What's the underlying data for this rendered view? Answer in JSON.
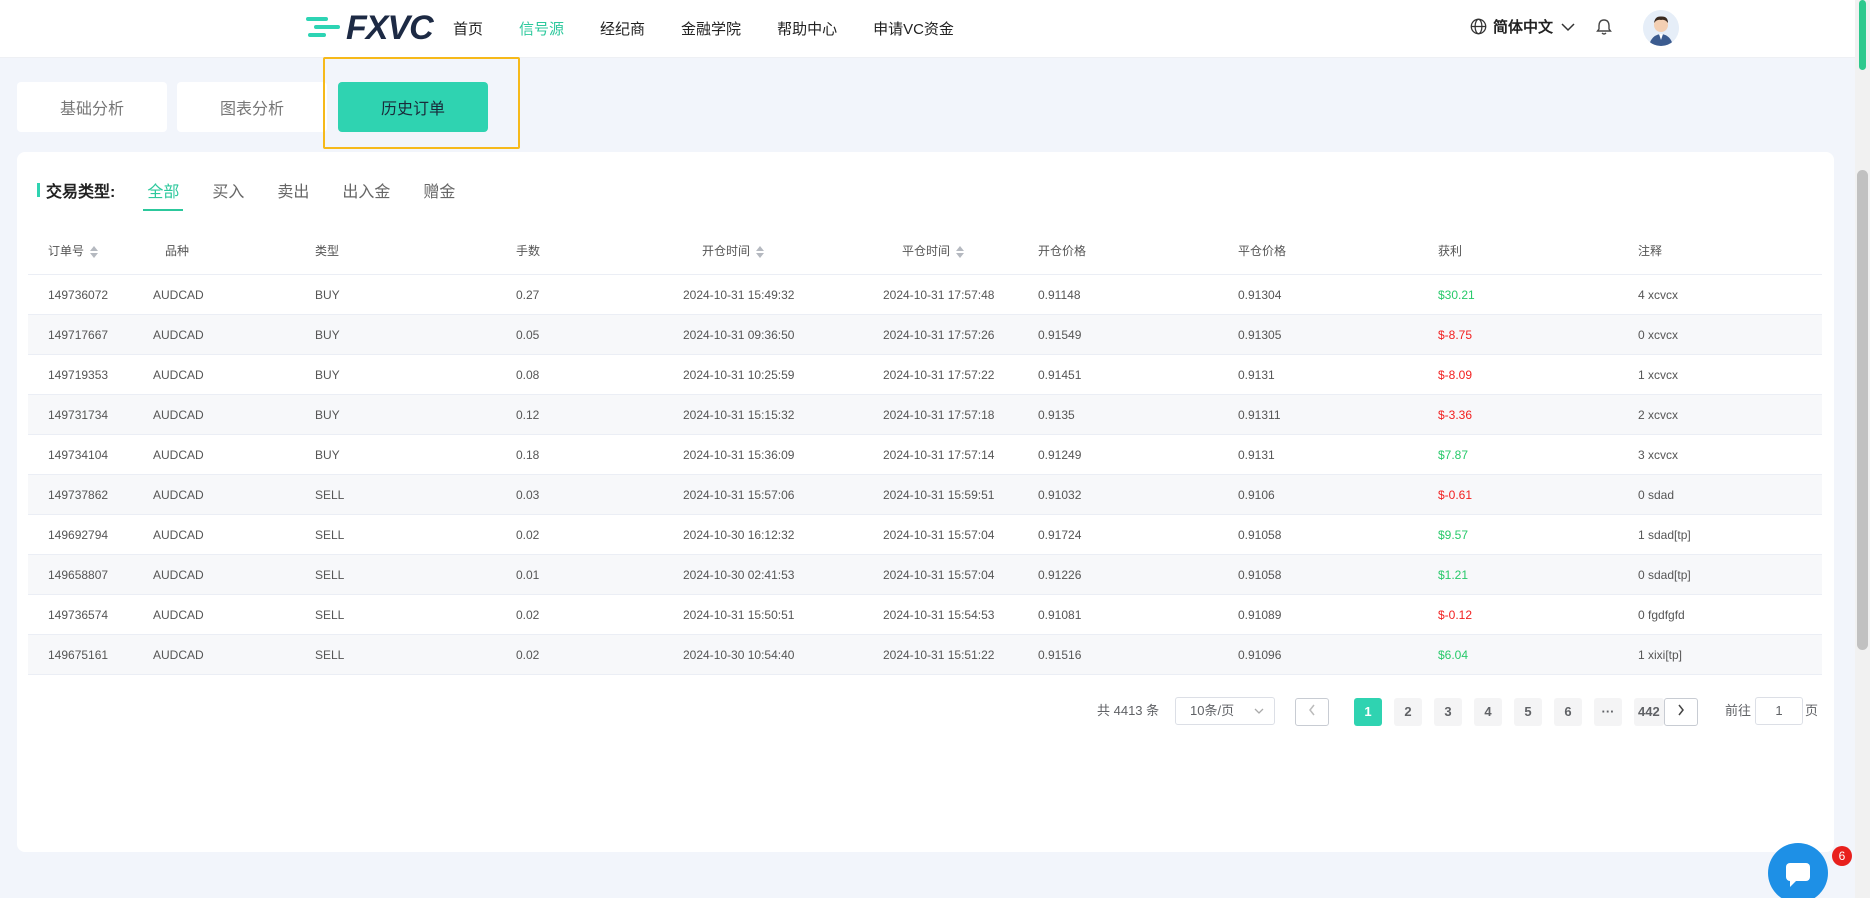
{
  "header": {
    "logo_text": "FXVC",
    "nav": [
      "首页",
      "信号源",
      "经纪商",
      "金融学院",
      "帮助中心",
      "申请VC资金"
    ],
    "active_nav": "信号源",
    "language": "简体中文"
  },
  "tabs": [
    {
      "label": "基础分析",
      "active": false
    },
    {
      "label": "图表分析",
      "active": false
    },
    {
      "label": "历史订单",
      "active": true
    }
  ],
  "filter": {
    "title": "交易类型:",
    "items": [
      "全部",
      "买入",
      "卖出",
      "出入金",
      "赠金"
    ],
    "active": "全部"
  },
  "table": {
    "columns": [
      "订单号",
      "品种",
      "类型",
      "手数",
      "开仓时间",
      "平仓时间",
      "开仓价格",
      "平仓价格",
      "获利",
      "注释"
    ],
    "rows": [
      [
        "149736072",
        "AUDCAD",
        "BUY",
        "0.27",
        "2024-10-31 15:49:32",
        "2024-10-31 17:57:48",
        "0.91148",
        "0.91304",
        "$30.21",
        "4 xcvcx"
      ],
      [
        "149717667",
        "AUDCAD",
        "BUY",
        "0.05",
        "2024-10-31 09:36:50",
        "2024-10-31 17:57:26",
        "0.91549",
        "0.91305",
        "$-8.75",
        "0 xcvcx"
      ],
      [
        "149719353",
        "AUDCAD",
        "BUY",
        "0.08",
        "2024-10-31 10:25:59",
        "2024-10-31 17:57:22",
        "0.91451",
        "0.9131",
        "$-8.09",
        "1 xcvcx"
      ],
      [
        "149731734",
        "AUDCAD",
        "BUY",
        "0.12",
        "2024-10-31 15:15:32",
        "2024-10-31 17:57:18",
        "0.9135",
        "0.91311",
        "$-3.36",
        "2 xcvcx"
      ],
      [
        "149734104",
        "AUDCAD",
        "BUY",
        "0.18",
        "2024-10-31 15:36:09",
        "2024-10-31 17:57:14",
        "0.91249",
        "0.9131",
        "$7.87",
        "3 xcvcx"
      ],
      [
        "149737862",
        "AUDCAD",
        "SELL",
        "0.03",
        "2024-10-31 15:57:06",
        "2024-10-31 15:59:51",
        "0.91032",
        "0.9106",
        "$-0.61",
        "0 sdad"
      ],
      [
        "149692794",
        "AUDCAD",
        "SELL",
        "0.02",
        "2024-10-30 16:12:32",
        "2024-10-31 15:57:04",
        "0.91724",
        "0.91058",
        "$9.57",
        "1 sdad[tp]"
      ],
      [
        "149658807",
        "AUDCAD",
        "SELL",
        "0.01",
        "2024-10-30 02:41:53",
        "2024-10-31 15:57:04",
        "0.91226",
        "0.91058",
        "$1.21",
        "0 sdad[tp]"
      ],
      [
        "149736574",
        "AUDCAD",
        "SELL",
        "0.02",
        "2024-10-31 15:50:51",
        "2024-10-31 15:54:53",
        "0.91081",
        "0.91089",
        "$-0.12",
        "0 fgdfgfd"
      ],
      [
        "149675161",
        "AUDCAD",
        "SELL",
        "0.02",
        "2024-10-30 10:54:40",
        "2024-10-31 15:51:22",
        "0.91516",
        "0.91096",
        "$6.04",
        "1 xixi[tp]"
      ]
    ]
  },
  "pagination": {
    "total": "共 4413 条",
    "page_size": "10条/页",
    "pages": [
      "1",
      "2",
      "3",
      "4",
      "5",
      "6",
      "···",
      "442"
    ],
    "current": "1",
    "goto_label": "前往",
    "goto_value": "1",
    "page_suffix": "页"
  },
  "chat": {
    "badge": "6"
  },
  "colors": {
    "accent": "#2fd3b1",
    "nav_active": "#2cc89c",
    "profit": "#27c96a",
    "loss": "#f21f1f",
    "highlight": "#f6b91a"
  }
}
